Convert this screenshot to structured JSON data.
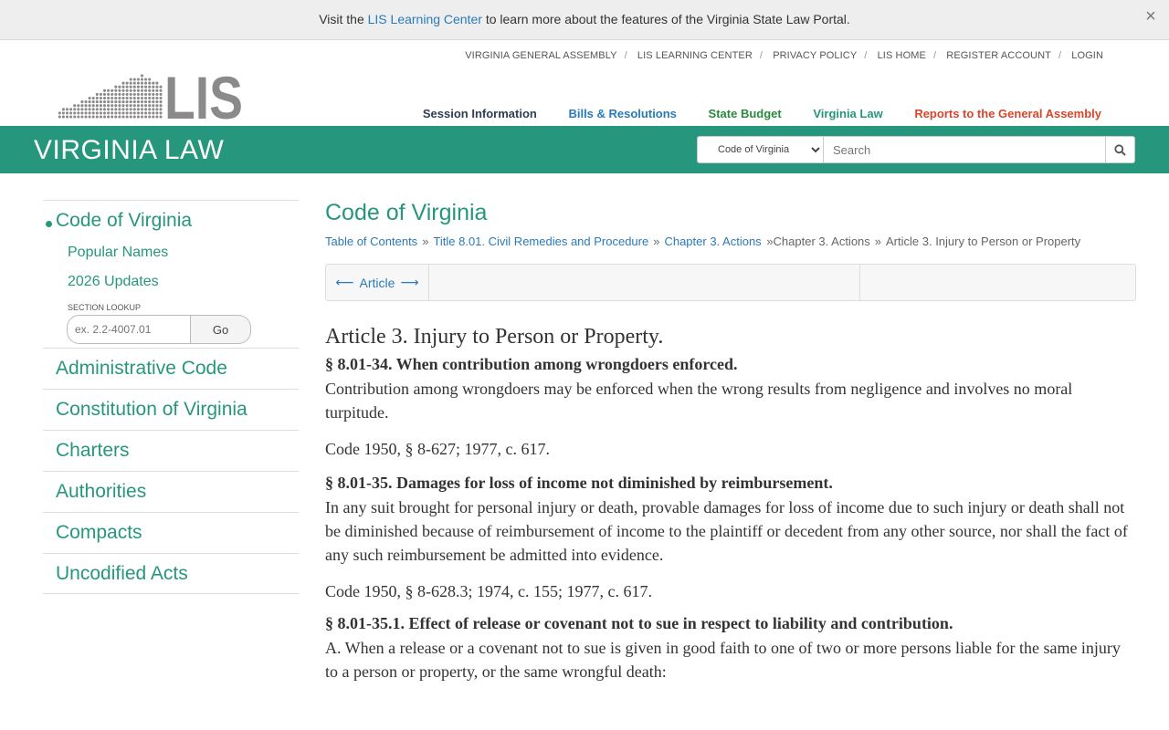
{
  "banner": {
    "prefix": "Visit the",
    "link": "LIS Learning Center",
    "suffix": "to learn more about the features of the Virginia State Law Portal.",
    "close": "×"
  },
  "logo": {
    "text": "LIS"
  },
  "toplinks": [
    "VIRGINIA GENERAL ASSEMBLY",
    "LIS LEARNING CENTER",
    "PRIVACY POLICY",
    "LIS HOME",
    "REGISTER ACCOUNT",
    "LOGIN"
  ],
  "mainnav": [
    {
      "label": "Session Information",
      "color": "#2c3e50"
    },
    {
      "label": "Bills & Resolutions",
      "color": "#2a7ab8"
    },
    {
      "label": "State Budget",
      "color": "#2a8a3c"
    },
    {
      "label": "Virginia Law",
      "color": "#26977c"
    },
    {
      "label": "Reports to the General Assembly",
      "color": "#d9452a"
    }
  ],
  "greenbar": {
    "title": "VIRGINIA LAW",
    "select_value": "Code of Virginia",
    "search_placeholder": "Search"
  },
  "sidebar": {
    "primary": "Code of Virginia",
    "subs": [
      "Popular Names",
      "2026 Updates"
    ],
    "lookup_label": "SECTION LOOKUP",
    "lookup_placeholder": "ex. 2.2-4007.01",
    "go_label": "Go",
    "items": [
      "Administrative Code",
      "Constitution of Virginia",
      "Charters",
      "Authorities",
      "Compacts",
      "Uncodified Acts"
    ]
  },
  "content": {
    "title": "Code of Virginia",
    "breadcrumbs": {
      "toc": "Table of Contents",
      "title": "Title 8.01. Civil Remedies and Procedure",
      "chapter": "Chapter 3. Actions",
      "chapter_plain": "Chapter 3. Actions",
      "article": "Article 3. Injury to Person or Property"
    },
    "nav_article": "Article",
    "article_heading": "Article 3. Injury to Person or Property.",
    "sections": [
      {
        "heading": "§ 8.01-34. When contribution among wrongdoers enforced.",
        "body": "Contribution among wrongdoers may be enforced when the wrong results from negligence and involves no moral turpitude.",
        "cite": "Code 1950, § 8-627; 1977, c. 617."
      },
      {
        "heading": "§ 8.01-35. Damages for loss of income not diminished by reimbursement.",
        "body": "In any suit brought for personal injury or death, provable damages for loss of income due to such injury or death shall not be diminished because of reimbursement of income to the plaintiff or decedent from any other source, nor shall the fact of any such reimbursement be admitted into evidence.",
        "cite": "Code 1950, § 8-628.3; 1974, c. 155; 1977, c. 617."
      },
      {
        "heading": "§ 8.01-35.1. Effect of release or covenant not to sue in respect to liability and contribution.",
        "body": "A. When a release or a covenant not to sue is given in good faith to one of two or more persons liable for the same injury to a person or property, or the same wrongful death:"
      }
    ]
  }
}
